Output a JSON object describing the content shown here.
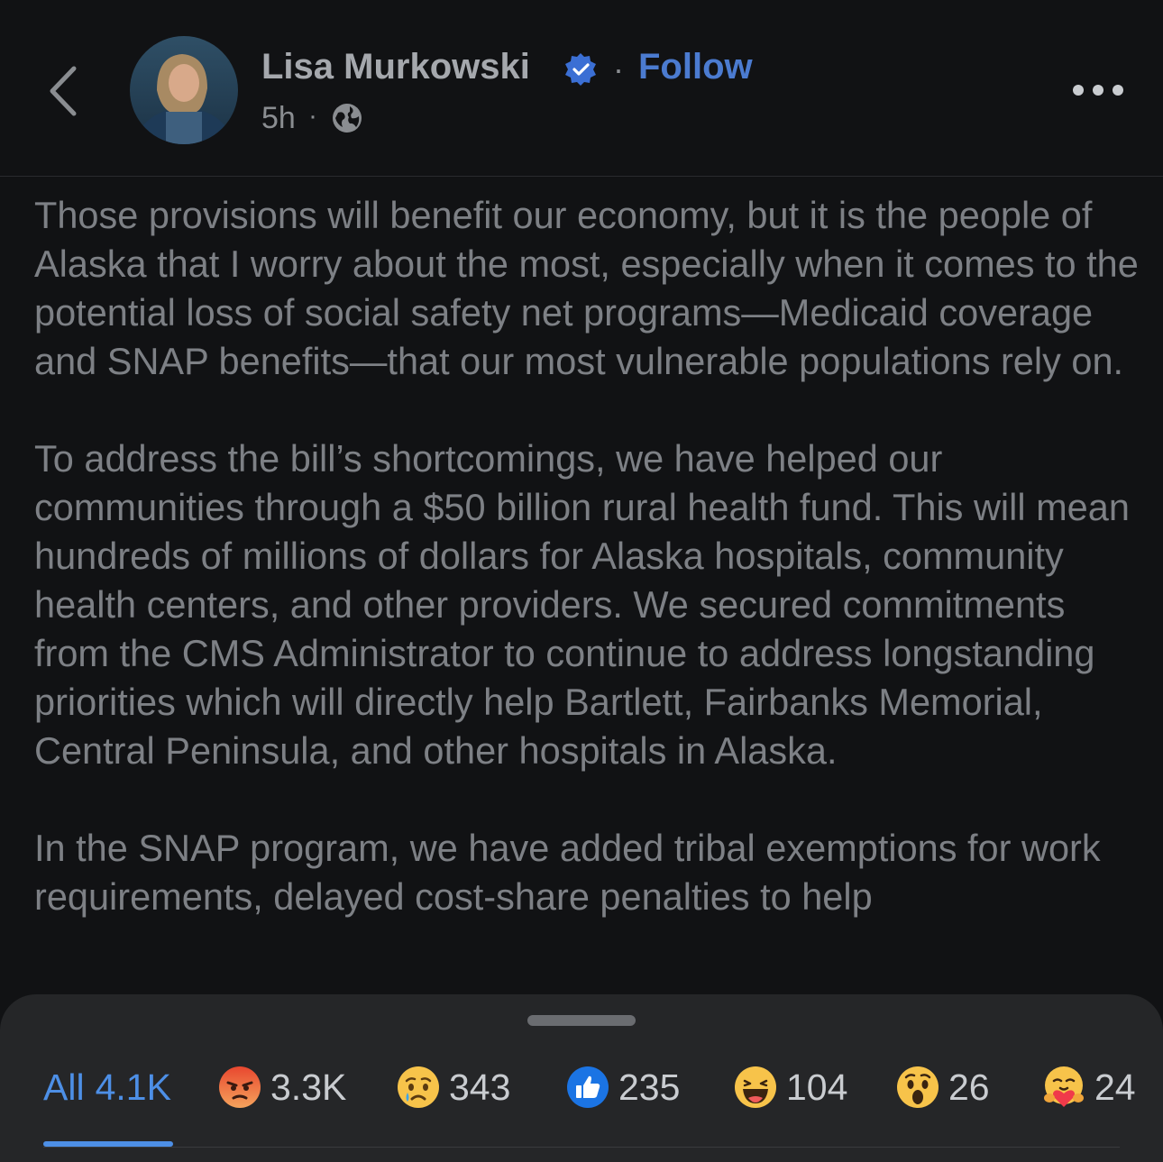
{
  "header": {
    "author_name": "Lisa Murkowski",
    "verified_icon": "verified-badge-icon",
    "separator": "·",
    "follow_label": "Follow",
    "timestamp": "5h",
    "time_separator": "·",
    "audience_icon": "globe-icon",
    "back_icon": "chevron-left-icon",
    "more_icon": "more-horizontal-icon"
  },
  "post": {
    "paragraphs": [
      "Those provisions will benefit our economy, but it is the people of Alaska that I worry about the most, especially when it comes to the potential loss of social safety net programs—Medicaid coverage and SNAP benefits—that our most vulnerable populations rely on.",
      "To address the bill’s shortcomings, we have helped our communities through a $50 billion rural health fund. This will mean hundreds of millions of dollars for Alaska hospitals, community health centers, and other providers. We secured commitments from the CMS Administrator to continue to address longstanding priorities which will directly help Bartlett, Fairbanks Memorial, Central Peninsula, and other hospitals in Alaska.",
      "In the SNAP program, we have added tribal exemptions for work requirements, delayed cost-share penalties to help"
    ]
  },
  "reactions": {
    "tabs": [
      {
        "label": "All",
        "count": "4.1K",
        "icon": null,
        "selected": true
      },
      {
        "label": "",
        "count": "3.3K",
        "icon": "angry-emoji-icon"
      },
      {
        "label": "",
        "count": "343",
        "icon": "sad-emoji-icon"
      },
      {
        "label": "",
        "count": "235",
        "icon": "like-icon"
      },
      {
        "label": "",
        "count": "104",
        "icon": "haha-emoji-icon"
      },
      {
        "label": "",
        "count": "26",
        "icon": "wow-emoji-icon"
      },
      {
        "label": "",
        "count": "24",
        "icon": "care-emoji-icon"
      }
    ]
  },
  "colors": {
    "background": "#111214",
    "sheet": "#252628",
    "accent_blue": "#4d8fe6",
    "follow_blue": "#4b7bd0",
    "post_text": "#7d8085"
  }
}
